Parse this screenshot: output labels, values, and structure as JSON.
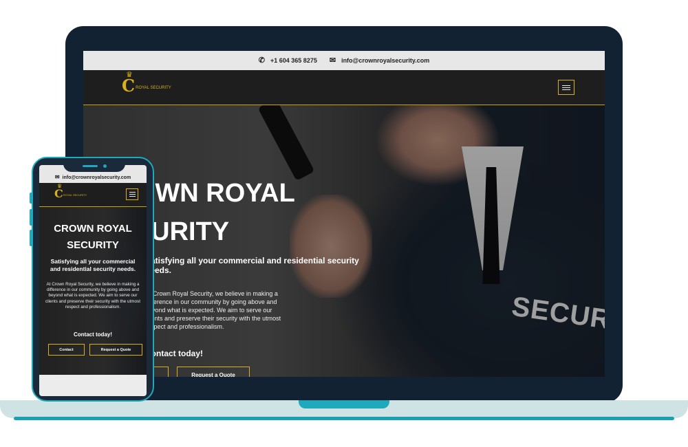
{
  "site": {
    "phone_number": "+1 604 365 8275",
    "email": "info@crownroyalsecurity.com",
    "logo_letter": "C",
    "logo_text": "ROYAL SECURITY",
    "phone_icon": "phone-icon",
    "mail_icon": "mail-icon",
    "menu_icon": "hamburger-icon"
  },
  "laptop_hero": {
    "title_line1": "CROWN ROYAL",
    "title_line2": "SECURITY",
    "subtitle": "Satisfying all your commercial and residential security needs.",
    "paragraph": "At Crown Royal Security, we believe in making a difference in our community by going above and beyond what is expected. We aim to serve our clients and preserve their security with the utmost respect and professionalism.",
    "cta_heading": "Contact today!",
    "contact_label": "Contact",
    "quote_label": "Request a Quote",
    "photo_text": "SECURITY"
  },
  "phone_hero": {
    "title_line1": "CROWN ROYAL",
    "title_line2": "SECURITY",
    "subtitle": "Satisfying all your commercial and residential security needs.",
    "paragraph": "At Crown Royal Security, we believe in making a difference in our community by going above and beyond what is expected. We aim to serve our clients and preserve their security with the utmost respect and professionalism.",
    "cta_heading": "Contact today!",
    "contact_label": "Contact",
    "quote_label": "Request a Quote"
  },
  "colors": {
    "accent_gold": "#d8b11c",
    "device_frame": "#132233",
    "device_teal": "#1fa9bd",
    "nav_bg": "#1e1e1e",
    "topbar_bg": "#e7e7e7"
  }
}
